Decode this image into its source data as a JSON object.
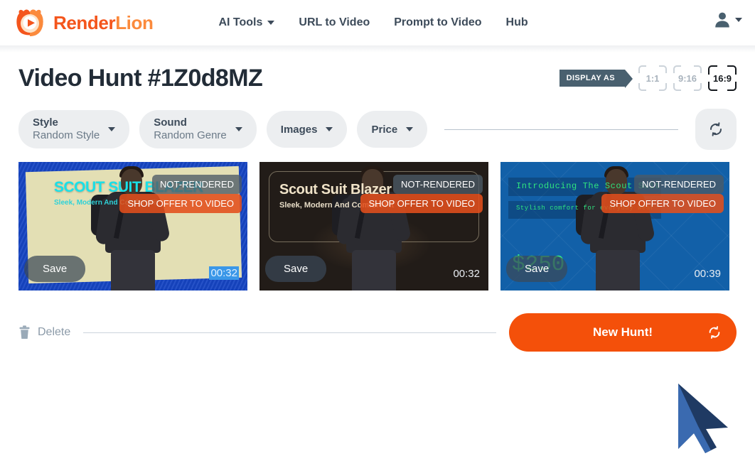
{
  "header": {
    "brand": {
      "part1": "Render",
      "part2": "Lion",
      "logo_icon": "lion-play-logo"
    },
    "nav": [
      {
        "label": "AI Tools",
        "has_caret": true
      },
      {
        "label": "URL to Video",
        "has_caret": false
      },
      {
        "label": "Prompt to Video",
        "has_caret": false
      },
      {
        "label": "Hub",
        "has_caret": false
      }
    ],
    "user_icon": "user-account-icon"
  },
  "title_row": {
    "title": "Video Hunt #1Z0d8MZ",
    "display_as_label": "DISPLAY AS",
    "ratios": [
      {
        "label": "1:1",
        "active": false
      },
      {
        "label": "9:16",
        "active": false
      },
      {
        "label": "16:9",
        "active": true
      }
    ]
  },
  "filters": {
    "style": {
      "label": "Style",
      "value": "Random Style"
    },
    "sound": {
      "label": "Sound",
      "value": "Random Genre"
    },
    "images": {
      "label": "Images"
    },
    "price": {
      "label": "Price"
    },
    "refresh_icon": "refresh-icon"
  },
  "cards": [
    {
      "title": "SCOUT SUIT BLAZER",
      "subtitle": "Sleek, Modern And Comfort Fit",
      "status_badge": "NOT-RENDERED",
      "shop_button": "SHOP OFFER TO VIDEO",
      "save_button": "Save",
      "duration": "00:32",
      "duration_selected": true,
      "bg_color": "#1645c4",
      "accent_color": "#19e0e8"
    },
    {
      "title": "Scout Suit Blazer",
      "subtitle": "Sleek, Modern And Comfort Fit",
      "status_badge": "NOT-RENDERED",
      "shop_button": "SHOP OFFER TO VIDEO",
      "save_button": "Save",
      "duration": "00:32",
      "duration_selected": false,
      "bg_color": "#221c18",
      "accent_color": "#f0e3c8"
    },
    {
      "title": "Introducing The Scout Suit",
      "subtitle": "Stylish comfort for everyday wear",
      "price": "$250",
      "status_badge": "NOT-RENDERED",
      "shop_button": "SHOP OFFER TO VIDEO",
      "save_button": "Save",
      "duration": "00:39",
      "duration_selected": false,
      "bg_color": "#1260a8",
      "accent_color": "#2fe47f"
    }
  ],
  "bottom": {
    "delete_label": "Delete",
    "delete_icon": "trash-icon",
    "new_hunt_label": "New Hunt!",
    "new_hunt_refresh_icon": "refresh-icon"
  },
  "colors": {
    "brand_orange": "#f4551c",
    "brand_light_orange": "#fb8a3c",
    "cta_orange": "#f4500a",
    "nav_text": "#3d4b5a",
    "title_text": "#222c37",
    "pill_bg": "#eceef0"
  }
}
